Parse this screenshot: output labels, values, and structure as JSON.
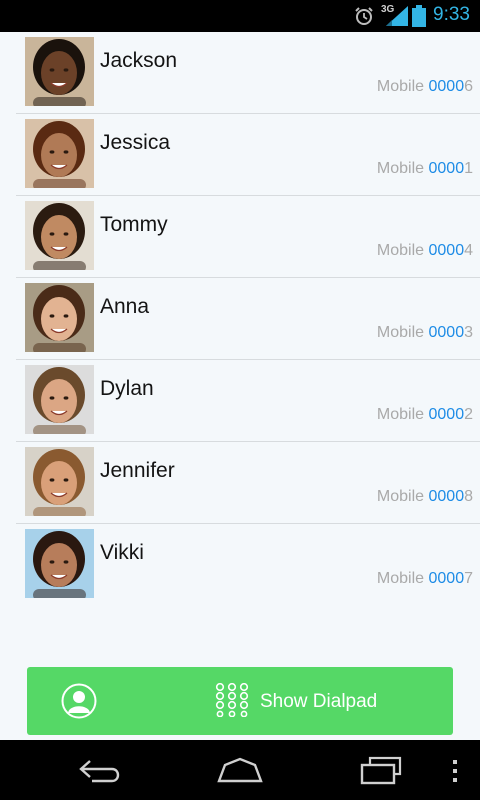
{
  "status_bar": {
    "network_label": "3G",
    "time": "9:33"
  },
  "contacts": [
    {
      "name": "Jackson",
      "number_type": "Mobile",
      "number_digits": "0000",
      "number_last": "6",
      "skin": "#6b4128",
      "hair": "#1a120c",
      "bg": "#c9b59a"
    },
    {
      "name": "Jessica",
      "number_type": "Mobile",
      "number_digits": "0000",
      "number_last": "1",
      "skin": "#b07a56",
      "hair": "#5a2a12",
      "bg": "#d8c1a8"
    },
    {
      "name": "Tommy",
      "number_type": "Mobile",
      "number_digits": "0000",
      "number_last": "4",
      "skin": "#c08a62",
      "hair": "#2b1b10",
      "bg": "#e3ddd2"
    },
    {
      "name": "Anna",
      "number_type": "Mobile",
      "number_digits": "0000",
      "number_last": "3",
      "skin": "#e2b392",
      "hair": "#4a2b18",
      "bg": "#a89c85"
    },
    {
      "name": "Dylan",
      "number_type": "Mobile",
      "number_digits": "0000",
      "number_last": "2",
      "skin": "#dba684",
      "hair": "#6a4a2c",
      "bg": "#dcdcdc"
    },
    {
      "name": "Jennifer",
      "number_type": "Mobile",
      "number_digits": "0000",
      "number_last": "8",
      "skin": "#d9a079",
      "hair": "#8a5a30",
      "bg": "#d7d2c8"
    },
    {
      "name": "Vikki",
      "number_type": "Mobile",
      "number_digits": "0000",
      "number_last": "7",
      "skin": "#b77d5b",
      "hair": "#2a1810",
      "bg": "#a7d1ea"
    }
  ],
  "action_bar": {
    "contact_icon": "contact-person-icon",
    "dialpad_icon": "dialpad-grid-icon",
    "dialpad_label": "Show Dialpad",
    "color": "#55d866"
  },
  "nav_bar": {
    "icons": [
      "back-icon",
      "home-icon",
      "recent-apps-icon",
      "overflow-menu-icon"
    ]
  },
  "colors": {
    "accent": "#33b5e5",
    "number_digits": "#1e8ce6",
    "background": "#f4f8fb"
  }
}
